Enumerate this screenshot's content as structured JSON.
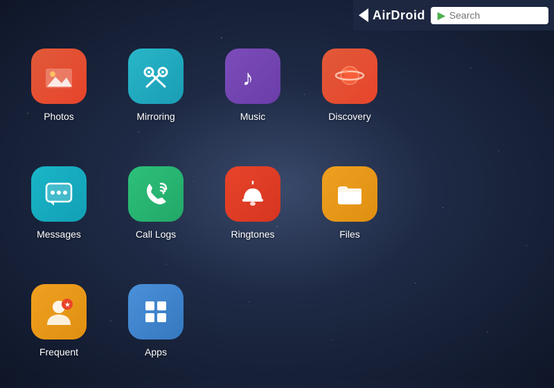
{
  "topbar": {
    "logo_text": "AirDroid",
    "search_placeholder": "Search"
  },
  "apps": [
    {
      "id": "photos",
      "label": "Photos",
      "icon_class": "icon-photos",
      "icon_name": "photos-icon",
      "row": 1,
      "col": 1
    },
    {
      "id": "mirroring",
      "label": "Mirroring",
      "icon_class": "icon-mirroring",
      "icon_name": "mirroring-icon",
      "row": 1,
      "col": 2
    },
    {
      "id": "music",
      "label": "Music",
      "icon_class": "icon-music",
      "icon_name": "music-icon",
      "row": 1,
      "col": 3
    },
    {
      "id": "discovery",
      "label": "Discovery",
      "icon_class": "icon-discovery",
      "icon_name": "discovery-icon",
      "row": 1,
      "col": 4
    },
    {
      "id": "messages",
      "label": "Messages",
      "icon_class": "icon-messages",
      "icon_name": "messages-icon",
      "row": 2,
      "col": 1
    },
    {
      "id": "calllogs",
      "label": "Call Logs",
      "icon_class": "icon-calllogs",
      "icon_name": "calllogs-icon",
      "row": 2,
      "col": 2
    },
    {
      "id": "ringtones",
      "label": "Ringtones",
      "icon_class": "icon-ringtones",
      "icon_name": "ringtones-icon",
      "row": 2,
      "col": 3
    },
    {
      "id": "files",
      "label": "Files",
      "icon_class": "icon-files",
      "icon_name": "files-icon",
      "row": 3,
      "col": 1
    },
    {
      "id": "frequent",
      "label": "Frequent",
      "icon_class": "icon-frequent",
      "icon_name": "frequent-icon",
      "row": 3,
      "col": 2
    },
    {
      "id": "apps",
      "label": "Apps",
      "icon_class": "icon-apps",
      "icon_name": "apps-icon",
      "row": 3,
      "col": 3
    }
  ]
}
